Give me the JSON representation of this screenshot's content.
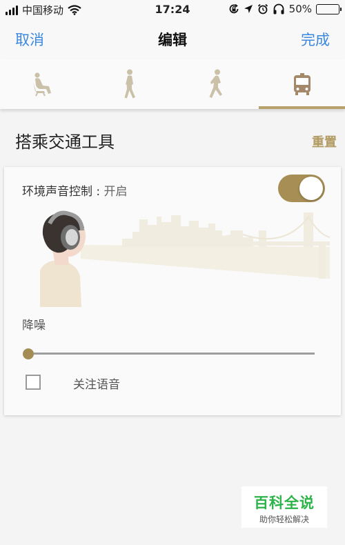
{
  "status_bar": {
    "carrier": "中国移动",
    "time": "17:24",
    "battery": "50%",
    "battery_level": 0.5,
    "icons": [
      "signal-bars-icon",
      "wifi-icon",
      "orientation-lock-icon",
      "location-arrow-icon",
      "alarm-icon",
      "headphones-icon",
      "battery-icon"
    ]
  },
  "nav": {
    "cancel": "取消",
    "title": "编辑",
    "done": "完成"
  },
  "tabs": [
    {
      "icon": "sitting-person-icon",
      "active": false
    },
    {
      "icon": "walking-person-icon",
      "active": false
    },
    {
      "icon": "running-person-icon",
      "active": false
    },
    {
      "icon": "bus-icon",
      "active": true
    }
  ],
  "section": {
    "title": "搭乘交通工具",
    "reset": "重置"
  },
  "card": {
    "ambient_label": "环境声音控制",
    "ambient_sep": ":",
    "ambient_state": "开启",
    "ambient_on": true,
    "noise_label": "降噪",
    "noise_level": 0,
    "voice_focus_label": "关注语音",
    "voice_focus_checked": false
  },
  "watermark": {
    "title": "百科全说",
    "subtitle": "助你轻松解决"
  },
  "colors": {
    "accent_blue": "#3a87e0",
    "gold": "#a68e54",
    "gold_text": "#b29b63",
    "watermark_green": "#2db34a"
  }
}
